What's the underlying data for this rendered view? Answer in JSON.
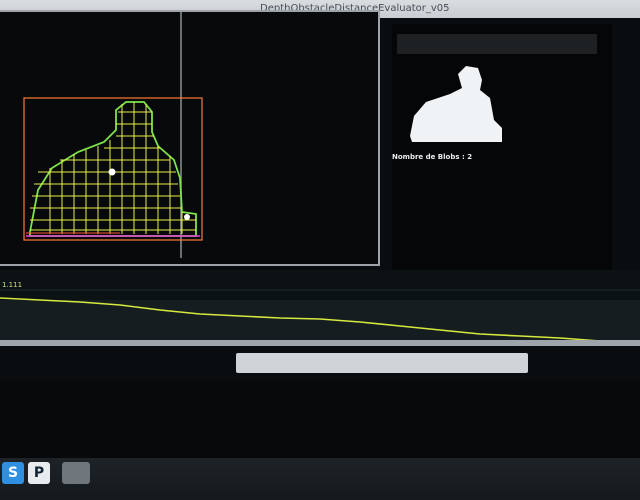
{
  "window": {
    "title": "DepthObstacleDistanceEvaluator_v05"
  },
  "depth_view": {
    "blob_count_label": "Nombre de Blobs : 2"
  },
  "graph": {
    "value_label": "1.111"
  },
  "taskbar": {
    "items": [
      {
        "name": "skype-icon"
      },
      {
        "name": "p-app-icon",
        "label": "P"
      },
      {
        "name": "window-thumbnail-icon"
      }
    ]
  },
  "colors": {
    "grid": "#e8f04a",
    "contour_green": "#7ee34a",
    "contour_orange": "#ff7a33",
    "signal": "#d6e93e"
  }
}
